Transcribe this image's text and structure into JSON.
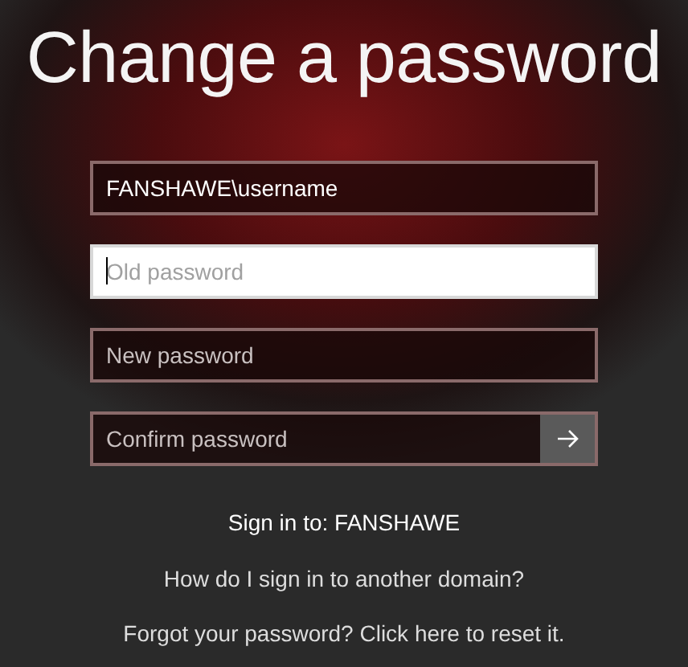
{
  "title": "Change a password",
  "fields": [
    {
      "value": "FANSHAWE\\username",
      "focused": false,
      "submit": false
    },
    {
      "placeholder": "Old password",
      "focused": true,
      "submit": false
    },
    {
      "placeholder": "New password",
      "focused": false,
      "submit": false
    },
    {
      "placeholder": "Confirm password",
      "focused": false,
      "submit": true
    }
  ],
  "sign_in_to": "Sign in to: FANSHAWE",
  "links": [
    "How do I sign in to another domain?",
    "Forgot your password? Click here to reset it."
  ]
}
